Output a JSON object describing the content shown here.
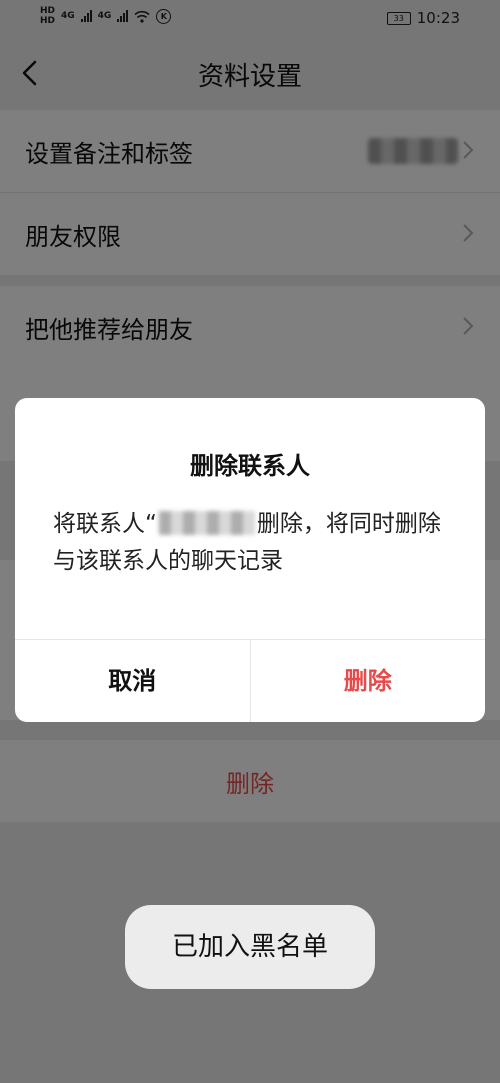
{
  "status_bar": {
    "hd1": "HD",
    "hd2": "HD",
    "net1": "4G",
    "net2": "4G",
    "k_icon": "K",
    "battery": "33",
    "time": "10:23"
  },
  "nav": {
    "title": "资料设置"
  },
  "settings": {
    "group1": [
      {
        "label": "设置备注和标签"
      },
      {
        "label": "朋友权限"
      }
    ],
    "group2": [
      {
        "label": "把他推荐给朋友"
      }
    ],
    "delete_label": "删除"
  },
  "dialog": {
    "title": "删除联系人",
    "message_prefix": "将联系人“",
    "message_suffix": "删除，将同时删除与该联系人的聊天记录",
    "cancel_label": "取消",
    "confirm_label": "删除"
  },
  "toast": {
    "text": "已加入黑名单"
  },
  "colors": {
    "accent_red": "#e84a4a",
    "background": "#ededed"
  }
}
